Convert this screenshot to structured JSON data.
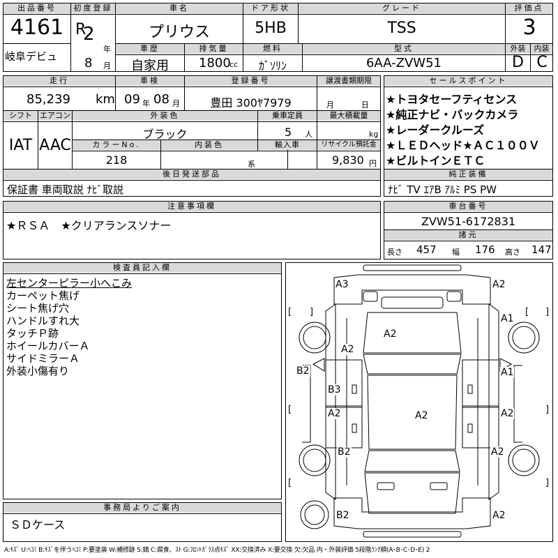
{
  "top": {
    "lot_no_label": "出品番号",
    "lot_no": "4161",
    "region": "岐阜デビュ",
    "first_reg_label": "初度登録",
    "era": "R",
    "year": "2",
    "year_unit": "年",
    "month": "8",
    "month_unit": "月",
    "car_name_label": "車名",
    "car_name": "プリウス",
    "door_label": "ドア形状",
    "door": "5HB",
    "grade_label": "グレード",
    "grade": "TSS",
    "score_label": "評価点",
    "score": "3",
    "history_label": "車歴",
    "history": "自家用",
    "displacement_label": "排気量",
    "displacement": "1800",
    "displacement_unit": "cc",
    "fuel_label": "燃料",
    "fuel": "ｶﾞｿﾘﾝ",
    "model_label": "型式",
    "model": "6AA-ZVW51",
    "exterior_label": "外装",
    "exterior": "D",
    "interior_label": "内装",
    "interior": "C"
  },
  "mid": {
    "mileage_label": "走行",
    "mileage": "85,239",
    "mileage_unit": "km",
    "inspection_label": "車検",
    "insp_year": "09",
    "insp_year_unit": "年",
    "insp_month": "08",
    "insp_month_unit": "月",
    "plate_label": "登録番号",
    "plate": "豊田 300ﾔ7979",
    "transfer_label": "譲渡書類期限",
    "transfer_month_unit": "月",
    "transfer_day_unit": "日",
    "shift_label": "シフト",
    "shift": "IAT",
    "ac_label": "エアコン",
    "ac": "AAC",
    "color_label": "外装色",
    "color": "ブラック",
    "capacity_label": "乗車定員",
    "capacity": "5",
    "capacity_unit": "人",
    "load_label": "最大積載量",
    "load_unit": "kg",
    "color_no_label": "カラーNo.",
    "color_no": "218",
    "int_color_label": "内装色",
    "int_color_unit": "系",
    "import_label": "輸入車",
    "recycle_label": "リサイクル預託金",
    "recycle": "9,830",
    "recycle_unit": "円",
    "later_label": "後日発送部品",
    "later": "保証書 車両取説 ﾅﾋﾞ取説"
  },
  "sales": {
    "label": "セールスポイント",
    "points": [
      "★トヨタセーフティセンス",
      "★純正ナビ・バックカメラ",
      "★レーダークルーズ",
      "★ＬＥＤヘッド★ＡＣ１００Ｖ",
      "★ビルトインＥＴＣ"
    ]
  },
  "equip": {
    "label": "純正装備",
    "value": "ﾅﾋﾞ TV ｴｱB ｱﾙﾐ PS PW"
  },
  "notes": {
    "label": "注意事項欄",
    "value": "★ＲＳＡ　★クリアランスソナー"
  },
  "chassis": {
    "label": "車台番号",
    "value": "ZVW51-6172831"
  },
  "dims": {
    "label": "諸元",
    "length_label": "長さ",
    "length": "457",
    "width_label": "幅",
    "width": "176",
    "height_label": "高さ",
    "height": "147"
  },
  "inspector": {
    "label": "検査員記入欄",
    "lines": [
      "左センターピラー小へこみ",
      "カーペット焦げ",
      "シート焦げ穴",
      "ハンドルすれ大",
      "タッチＰ跡",
      "ホイールカバーＡ",
      "サイドミラーＡ",
      "外装小傷有り"
    ]
  },
  "office": {
    "label": "事務局よりご案内",
    "value": "ＳＤケース"
  },
  "diagram": {
    "marks": [
      "A3",
      "A2",
      "A1",
      "A2",
      "A1",
      "B2",
      "B3",
      "A2",
      "A2",
      "A2",
      "A2",
      "B2",
      "A2",
      "B2",
      "A2"
    ],
    "bracket_left": "[",
    "bracket_right": "]"
  },
  "legend": "A:ｷｽﾞ U:ﾍｺﾐ B:ｷｽﾞを伴うﾍｺﾐ P:要塗装 W:補修跡 S:錆 C:腐食、ｽﾄ G:ﾌﾛﾝﾄｶﾞﾗｽ点ｷｽﾞ XX:交換済み X:要交換 欠:欠品 内・外装評価 5段階ﾗﾝｸ順(A･B･C･D･E) 2"
}
